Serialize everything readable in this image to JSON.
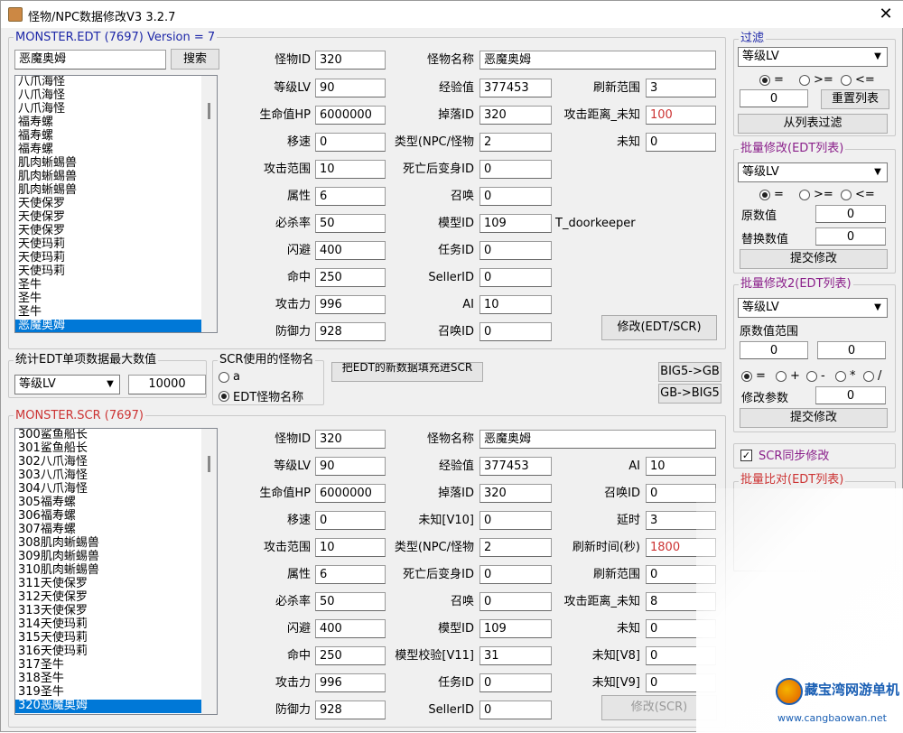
{
  "window": {
    "title": "怪物/NPC数据修改V3 3.2.7",
    "close": "✕"
  },
  "edt_group": {
    "label": "MONSTER.EDT (7697) Version = 7",
    "search_value": "恶魔奥姆",
    "search_button": "搜索",
    "list": [
      "八爪海怪",
      "八爪海怪",
      "八爪海怪",
      "福寿螺",
      "福寿螺",
      "福寿螺",
      "肌肉蜥蜴兽",
      "肌肉蜥蜴兽",
      "肌肉蜥蜴兽",
      "天使保罗",
      "天使保罗",
      "天使保罗",
      "天使玛莉",
      "天使玛莉",
      "天使玛莉",
      "圣牛",
      "圣牛",
      "圣牛",
      "恶魔奥姆"
    ]
  },
  "edt_fields": {
    "monster_id": {
      "label": "怪物ID",
      "value": "320"
    },
    "name": {
      "label": "怪物名称",
      "value": "恶魔奥姆"
    },
    "level": {
      "label": "等级LV",
      "value": "90"
    },
    "exp": {
      "label": "经验值",
      "value": "377453"
    },
    "refresh_range": {
      "label": "刷新范围",
      "value": "3"
    },
    "hp": {
      "label": "生命值HP",
      "value": "6000000"
    },
    "drop_id": {
      "label": "掉落ID",
      "value": "320"
    },
    "attack_dist": {
      "label": "攻击距离_未知",
      "value": "100"
    },
    "speed": {
      "label": "移速",
      "value": "0"
    },
    "type": {
      "label": "类型(NPC/怪物",
      "value": "2"
    },
    "unknown": {
      "label": "未知",
      "value": "0"
    },
    "attack_range": {
      "label": "攻击范围",
      "value": "10"
    },
    "death_transform": {
      "label": "死亡后变身ID",
      "value": "0"
    },
    "attribute": {
      "label": "属性",
      "value": "6"
    },
    "summon": {
      "label": "召唤",
      "value": "0"
    },
    "crit": {
      "label": "必杀率",
      "value": "50"
    },
    "model_id": {
      "label": "模型ID",
      "value": "109",
      "extra": "T_doorkeeper"
    },
    "dodge": {
      "label": "闪避",
      "value": "400"
    },
    "task_id": {
      "label": "任务ID",
      "value": "0"
    },
    "hit": {
      "label": "命中",
      "value": "250"
    },
    "seller_id": {
      "label": "SellerID",
      "value": "0"
    },
    "attack": {
      "label": "攻击力",
      "value": "996"
    },
    "ai": {
      "label": "AI",
      "value": "10"
    },
    "defense": {
      "label": "防御力",
      "value": "928"
    },
    "summon_id": {
      "label": "召唤ID",
      "value": "0"
    },
    "modify_button": "修改(EDT/SCR)"
  },
  "stats_group": {
    "label": "统计EDT单项数据最大数值",
    "select": "等级LV",
    "value": "10000"
  },
  "scr_name_group": {
    "label": "SCR使用的怪物名",
    "opt_a": "a",
    "opt_b": "EDT怪物名称"
  },
  "middle_button": "把EDT的新数据填充进SCR",
  "big5_gb": "BIG5->GB",
  "gb_big5": "GB->BIG5",
  "scr_group": {
    "label": "MONSTER.SCR (7697)",
    "list": [
      "300鲨鱼船长",
      "301鲨鱼船长",
      "302八爪海怪",
      "303八爪海怪",
      "304八爪海怪",
      "305福寿螺",
      "306福寿螺",
      "307福寿螺",
      "308肌肉蜥蜴兽",
      "309肌肉蜥蜴兽",
      "310肌肉蜥蜴兽",
      "311天使保罗",
      "312天使保罗",
      "313天使保罗",
      "314天使玛莉",
      "315天使玛莉",
      "316天使玛莉",
      "317圣牛",
      "318圣牛",
      "319圣牛",
      "320恶魔奥姆"
    ]
  },
  "scr_fields": {
    "monster_id": {
      "label": "怪物ID",
      "value": "320"
    },
    "name": {
      "label": "怪物名称",
      "value": "恶魔奥姆"
    },
    "level": {
      "label": "等级LV",
      "value": "90"
    },
    "exp": {
      "label": "经验值",
      "value": "377453"
    },
    "ai": {
      "label": "AI",
      "value": "10"
    },
    "hp": {
      "label": "生命值HP",
      "value": "6000000"
    },
    "drop_id": {
      "label": "掉落ID",
      "value": "320"
    },
    "summon_id": {
      "label": "召唤ID",
      "value": "0"
    },
    "speed": {
      "label": "移速",
      "value": "0"
    },
    "unknown_v10": {
      "label": "未知[V10]",
      "value": "0"
    },
    "delay": {
      "label": "延时",
      "value": "3"
    },
    "attack_range": {
      "label": "攻击范围",
      "value": "10"
    },
    "type": {
      "label": "类型(NPC/怪物",
      "value": "2"
    },
    "refresh_time": {
      "label": "刷新时间(秒)",
      "value": "1800"
    },
    "attribute": {
      "label": "属性",
      "value": "6"
    },
    "death_transform": {
      "label": "死亡后变身ID",
      "value": "0"
    },
    "refresh_range": {
      "label": "刷新范围",
      "value": "0"
    },
    "crit": {
      "label": "必杀率",
      "value": "50"
    },
    "summon": {
      "label": "召唤",
      "value": "0"
    },
    "attack_dist": {
      "label": "攻击距离_未知",
      "value": "8"
    },
    "dodge": {
      "label": "闪避",
      "value": "400"
    },
    "model_id": {
      "label": "模型ID",
      "value": "109"
    },
    "unknown": {
      "label": "未知",
      "value": "0"
    },
    "hit": {
      "label": "命中",
      "value": "250"
    },
    "model_check": {
      "label": "模型校验[V11]",
      "value": "31"
    },
    "unknown_v8": {
      "label": "未知[V8]",
      "value": "0"
    },
    "attack": {
      "label": "攻击力",
      "value": "996"
    },
    "task_id": {
      "label": "任务ID",
      "value": "0"
    },
    "unknown_v9": {
      "label": "未知[V9]",
      "value": "0"
    },
    "defense": {
      "label": "防御力",
      "value": "928"
    },
    "seller_id": {
      "label": "SellerID",
      "value": "0"
    },
    "modify_button": "修改(SCR)"
  },
  "filter_group": {
    "label": "过滤",
    "select": "等级LV",
    "eq": "=",
    "ge": ">=",
    "le": "<=",
    "value": "0",
    "reset_button": "重置列表",
    "filter_button": "从列表过滤"
  },
  "batch1_group": {
    "label": "批量修改(EDT列表)",
    "select": "等级LV",
    "eq": "=",
    "ge": ">=",
    "le": "<=",
    "orig_label": "原数值",
    "orig_value": "0",
    "replace_label": "替换数值",
    "replace_value": "0",
    "submit": "提交修改"
  },
  "batch2_group": {
    "label": "批量修改2(EDT列表)",
    "select": "等级LV",
    "range_label": "原数值范围",
    "range_from": "0",
    "range_to": "0",
    "ops": [
      "=",
      "+",
      "-",
      "*",
      "/"
    ],
    "param_label": "修改参数",
    "param_value": "0",
    "submit": "提交修改"
  },
  "scr_sync": {
    "label": "SCR同步修改",
    "checked": "✓"
  },
  "batch_compare": {
    "label": "批量比对(EDT列表)"
  },
  "watermark": {
    "line1": "藏宝湾网游单机",
    "line2": "www.cangbaowan.net"
  },
  "colors": {
    "blue_label": "#1d27a8",
    "red_label": "#c33333",
    "selection": "#0078d7"
  }
}
